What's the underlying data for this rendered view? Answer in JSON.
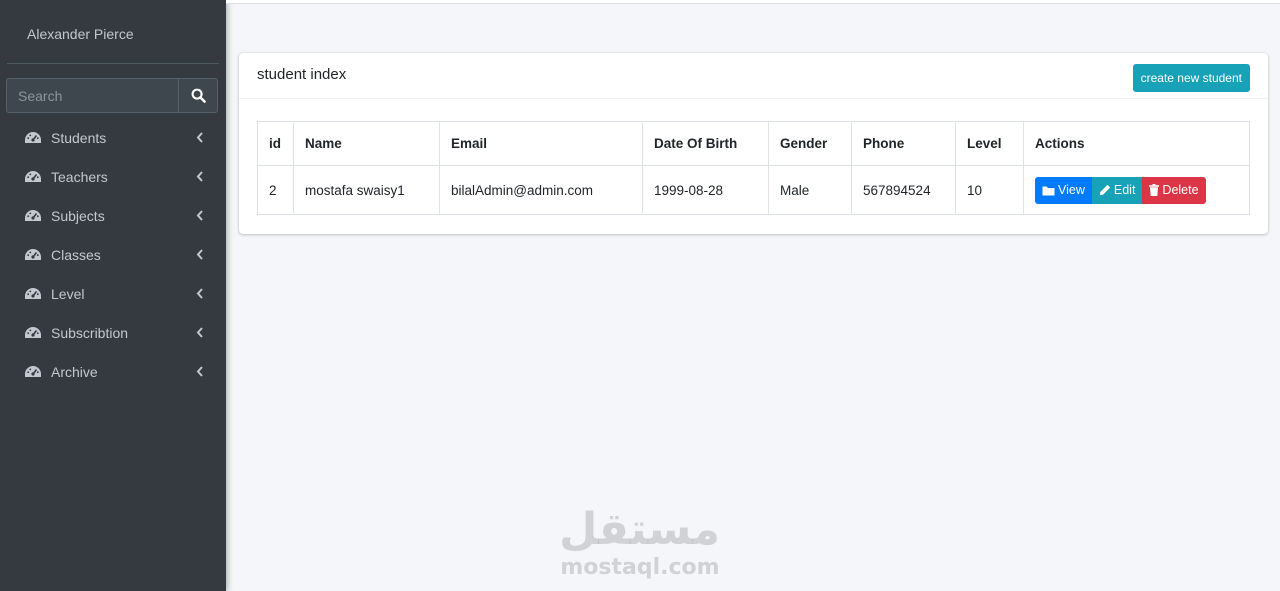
{
  "sidebar": {
    "user_name": "Alexander Pierce",
    "search": {
      "placeholder": "Search",
      "value": ""
    },
    "items": [
      {
        "label": "Students"
      },
      {
        "label": "Teachers"
      },
      {
        "label": "Subjects"
      },
      {
        "label": "Classes"
      },
      {
        "label": "Level"
      },
      {
        "label": "Subscribtion"
      },
      {
        "label": "Archive"
      }
    ],
    "item_icon": "tachometer-icon",
    "chevron_icon": "chevron-left-icon"
  },
  "card": {
    "title": "student index",
    "create_button": "create new student"
  },
  "table": {
    "headers": [
      "id",
      "Name",
      "Email",
      "Date Of Birth",
      "Gender",
      "Phone",
      "Level",
      "Actions"
    ],
    "rows": [
      {
        "id": "2",
        "name": "mostafa swaisy1",
        "email": "bilalAdmin@admin.com",
        "dob": "1999-08-28",
        "gender": "Male",
        "phone": "567894524",
        "level": "10",
        "actions": {
          "view": "View",
          "edit": "Edit",
          "delete": "Delete"
        }
      }
    ]
  },
  "watermark": {
    "arabic": "مستقل",
    "latin": "mostaql.com"
  },
  "colors": {
    "sidebar_bg": "#343a40",
    "primary": "#007bff",
    "info": "#17a2b8",
    "danger": "#dc3545",
    "content_bg": "#f4f6f9"
  }
}
